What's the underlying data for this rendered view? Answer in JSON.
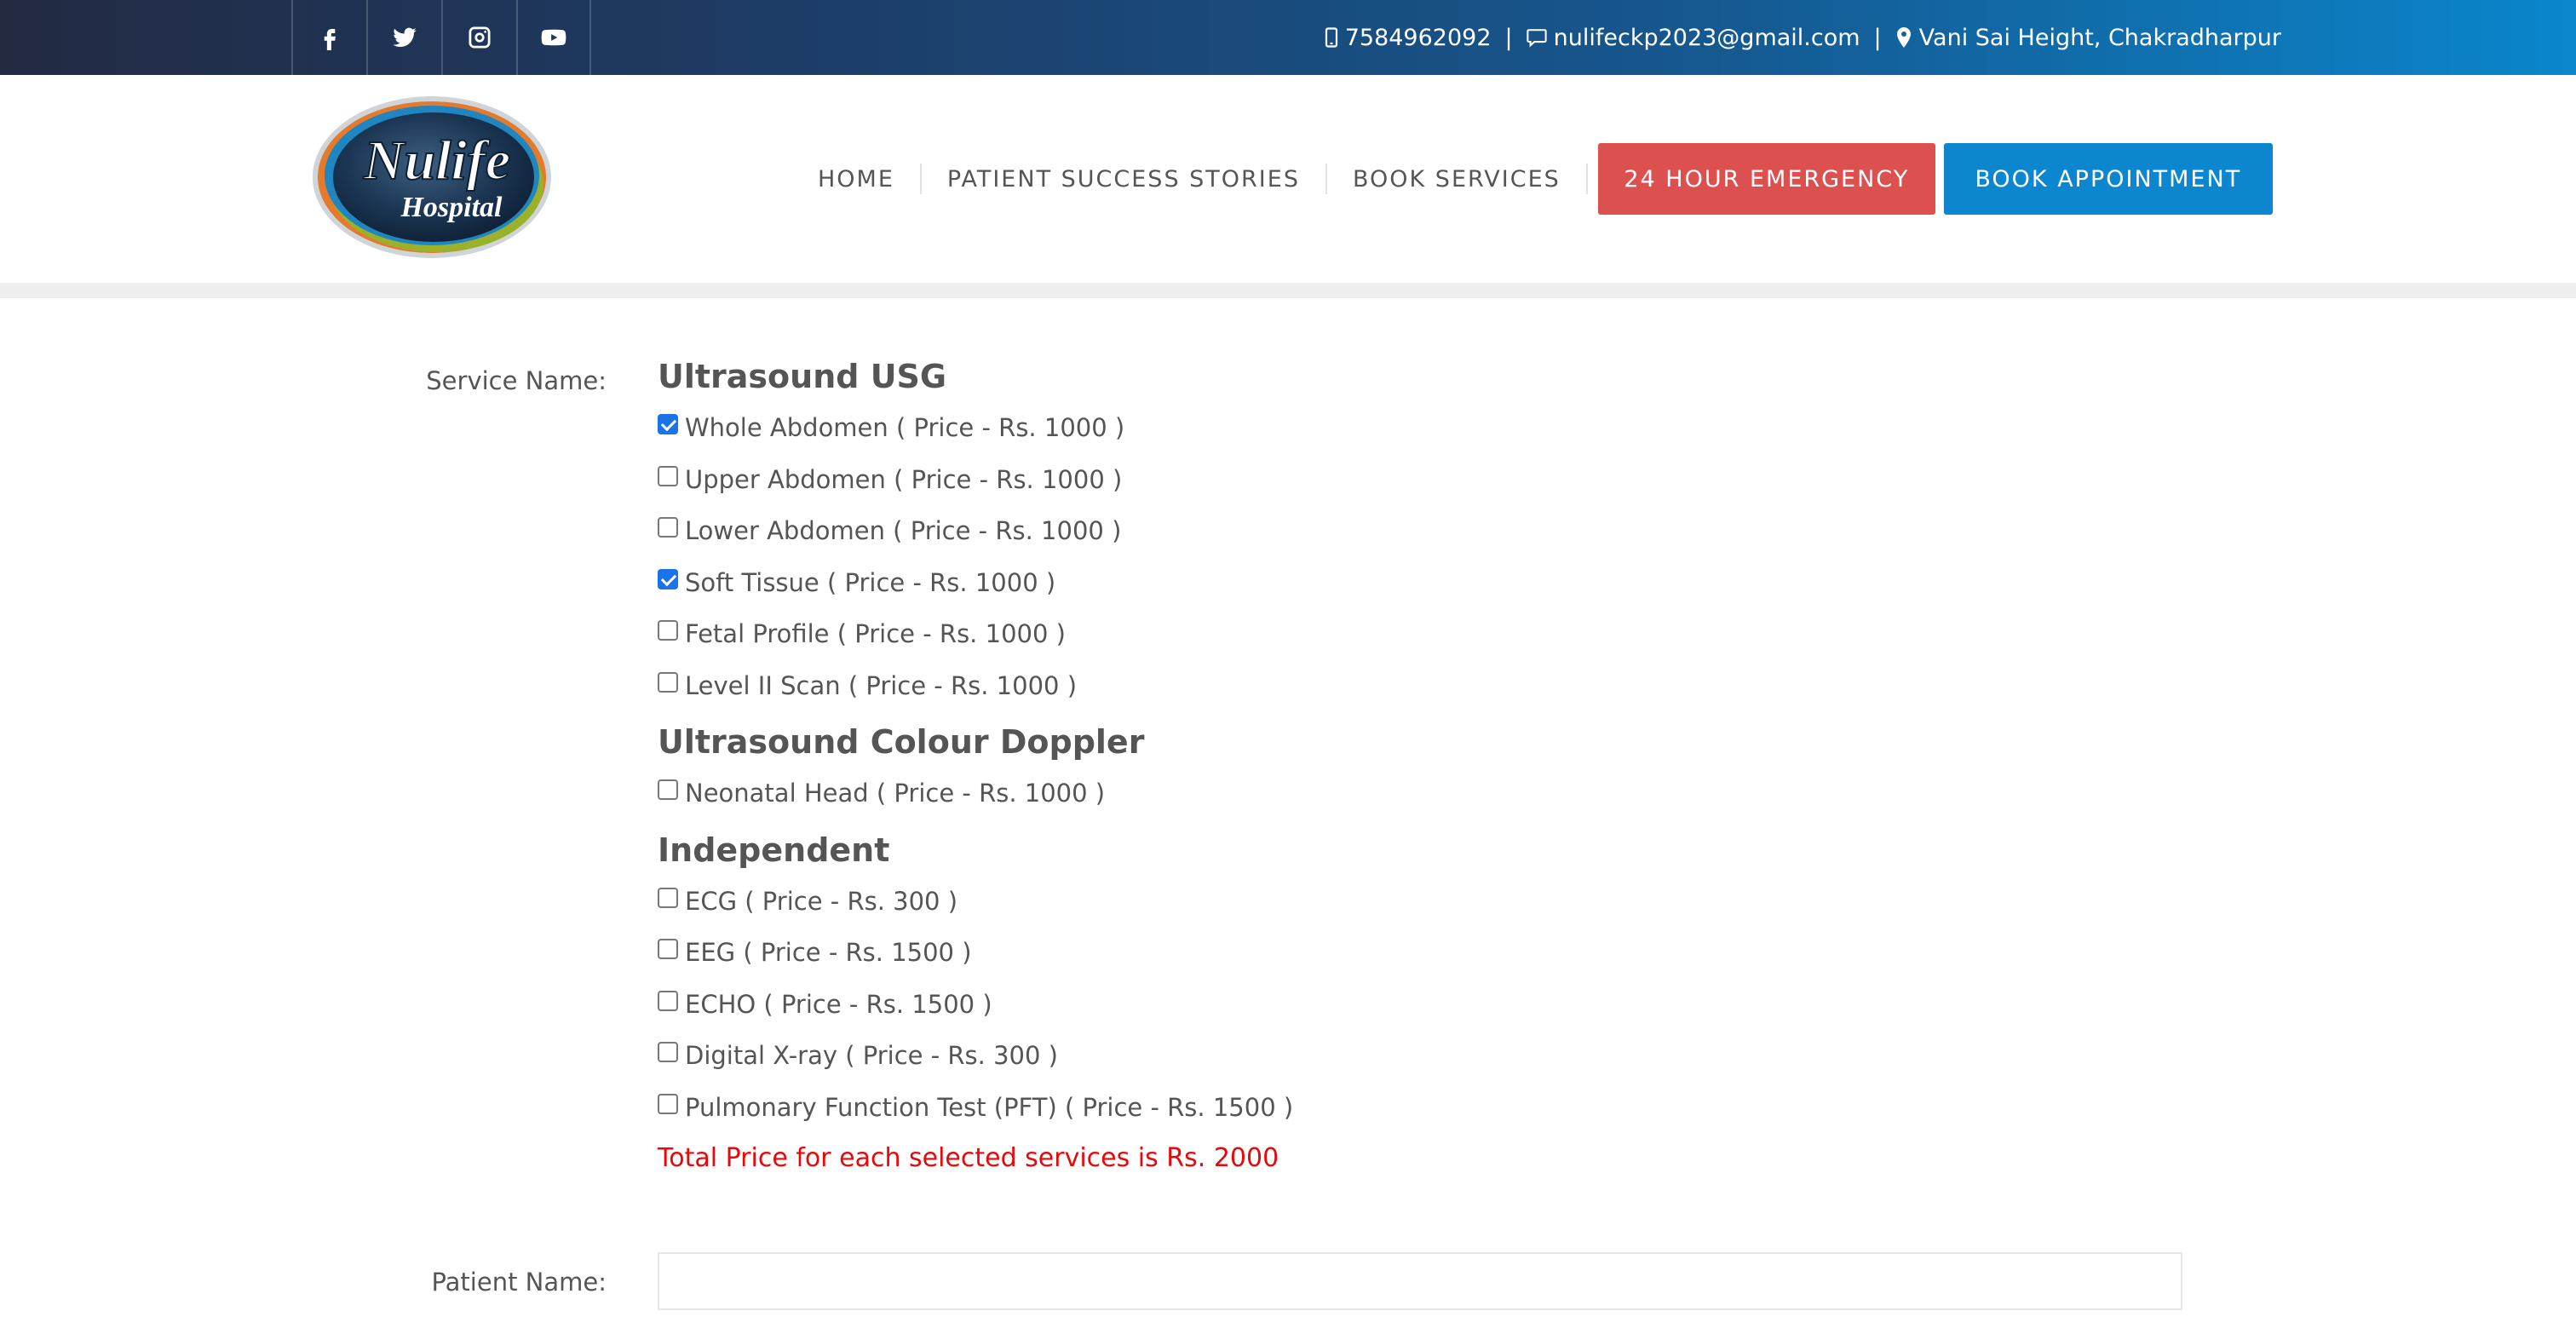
{
  "topbar": {
    "social": [
      {
        "name": "facebook-icon"
      },
      {
        "name": "twitter-icon"
      },
      {
        "name": "instagram-icon"
      },
      {
        "name": "youtube-icon"
      }
    ],
    "phone": "7584962092",
    "email": "nulifeckp2023@gmail.com",
    "address": "Vani Sai Height, Chakradharpur",
    "separator": "|"
  },
  "header": {
    "logo": {
      "line1": "Nulife",
      "line2": "Hospital"
    },
    "nav": [
      "HOME",
      "PATIENT SUCCESS STORIES",
      "BOOK SERVICES"
    ],
    "emergency_label": "24 HOUR EMERGENCY",
    "book_label": "BOOK APPOINTMENT",
    "colors": {
      "emergency": "#dd5050",
      "book": "#0b86cf"
    }
  },
  "form": {
    "service_label": "Service Name:",
    "patient_label": "Patient Name:",
    "patient_value": "",
    "groups": [
      {
        "title": "Ultrasound USG",
        "items": [
          {
            "label": "Whole Abdomen ( Price - Rs. 1000 )",
            "checked": true
          },
          {
            "label": "Upper Abdomen ( Price - Rs. 1000 )",
            "checked": false
          },
          {
            "label": "Lower Abdomen ( Price - Rs. 1000 )",
            "checked": false
          },
          {
            "label": "Soft Tissue ( Price - Rs. 1000 )",
            "checked": true
          },
          {
            "label": "Fetal Profile ( Price - Rs. 1000 )",
            "checked": false
          },
          {
            "label": "Level II Scan ( Price - Rs. 1000 )",
            "checked": false
          }
        ]
      },
      {
        "title": "Ultrasound Colour Doppler",
        "items": [
          {
            "label": "Neonatal Head ( Price - Rs. 1000 )",
            "checked": false
          }
        ]
      },
      {
        "title": "Independent",
        "items": [
          {
            "label": "ECG ( Price - Rs. 300 )",
            "checked": false
          },
          {
            "label": "EEG ( Price - Rs. 1500 )",
            "checked": false
          },
          {
            "label": "ECHO ( Price - Rs. 1500 )",
            "checked": false
          },
          {
            "label": "Digital X-ray ( Price - Rs. 300 )",
            "checked": false
          },
          {
            "label": "Pulmonary Function Test (PFT) ( Price - Rs. 1500 )",
            "checked": false
          }
        ]
      }
    ],
    "total_text": "Total Price for each selected services is Rs. 2000",
    "total_color": "#e8080a"
  }
}
